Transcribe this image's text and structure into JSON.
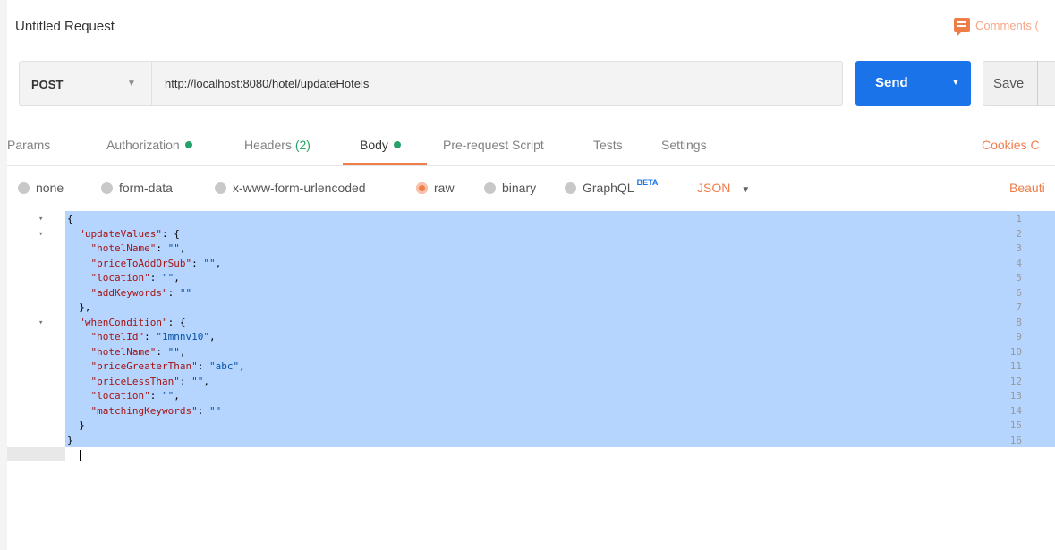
{
  "title": "Untitled Request",
  "comments_label": "Comments (",
  "request": {
    "method": "POST",
    "url": "http://localhost:8080/hotel/updateHotels",
    "send_label": "Send",
    "save_label": "Save"
  },
  "tabs": [
    {
      "label": "Params"
    },
    {
      "label": "Authorization"
    },
    {
      "label": "Headers",
      "count": "(2)"
    },
    {
      "label": "Body"
    },
    {
      "label": "Pre-request Script"
    },
    {
      "label": "Tests"
    },
    {
      "label": "Settings"
    }
  ],
  "cookies_label": "Cookies  C",
  "body_types": [
    "none",
    "form-data",
    "x-www-form-urlencoded",
    "raw",
    "binary",
    "GraphQL"
  ],
  "beta_label": "BETA",
  "selected_body_type": "raw",
  "format": "JSON",
  "beautify_label": "Beauti",
  "colors": {
    "accent": "#ef7d4a",
    "send": "#1a73e8",
    "status_dot": "#26a269",
    "selection": "#b5d5ff"
  },
  "editor": {
    "line_numbers": [
      "1",
      "2",
      "3",
      "4",
      "5",
      "6",
      "7",
      "8",
      "9",
      "10",
      "11",
      "12",
      "13",
      "14",
      "15",
      "16"
    ],
    "lines": [
      "{",
      "  \"updateValues\": {",
      "    \"hotelName\": \"\",",
      "    \"priceToAddOrSub\": \"\",",
      "    \"location\": \"\",",
      "    \"addKeywords\": \"\"",
      "  },",
      "  \"whenCondition\": {",
      "    \"hotelId\": \"1mnnv10\",",
      "    \"hotelName\": \"\",",
      "    \"priceGreaterThan\": \"abc\",",
      "    \"priceLessThan\": \"\",",
      "    \"location\": \"\",",
      "    \"matchingKeywords\": \"\"",
      "  }",
      "}"
    ]
  }
}
